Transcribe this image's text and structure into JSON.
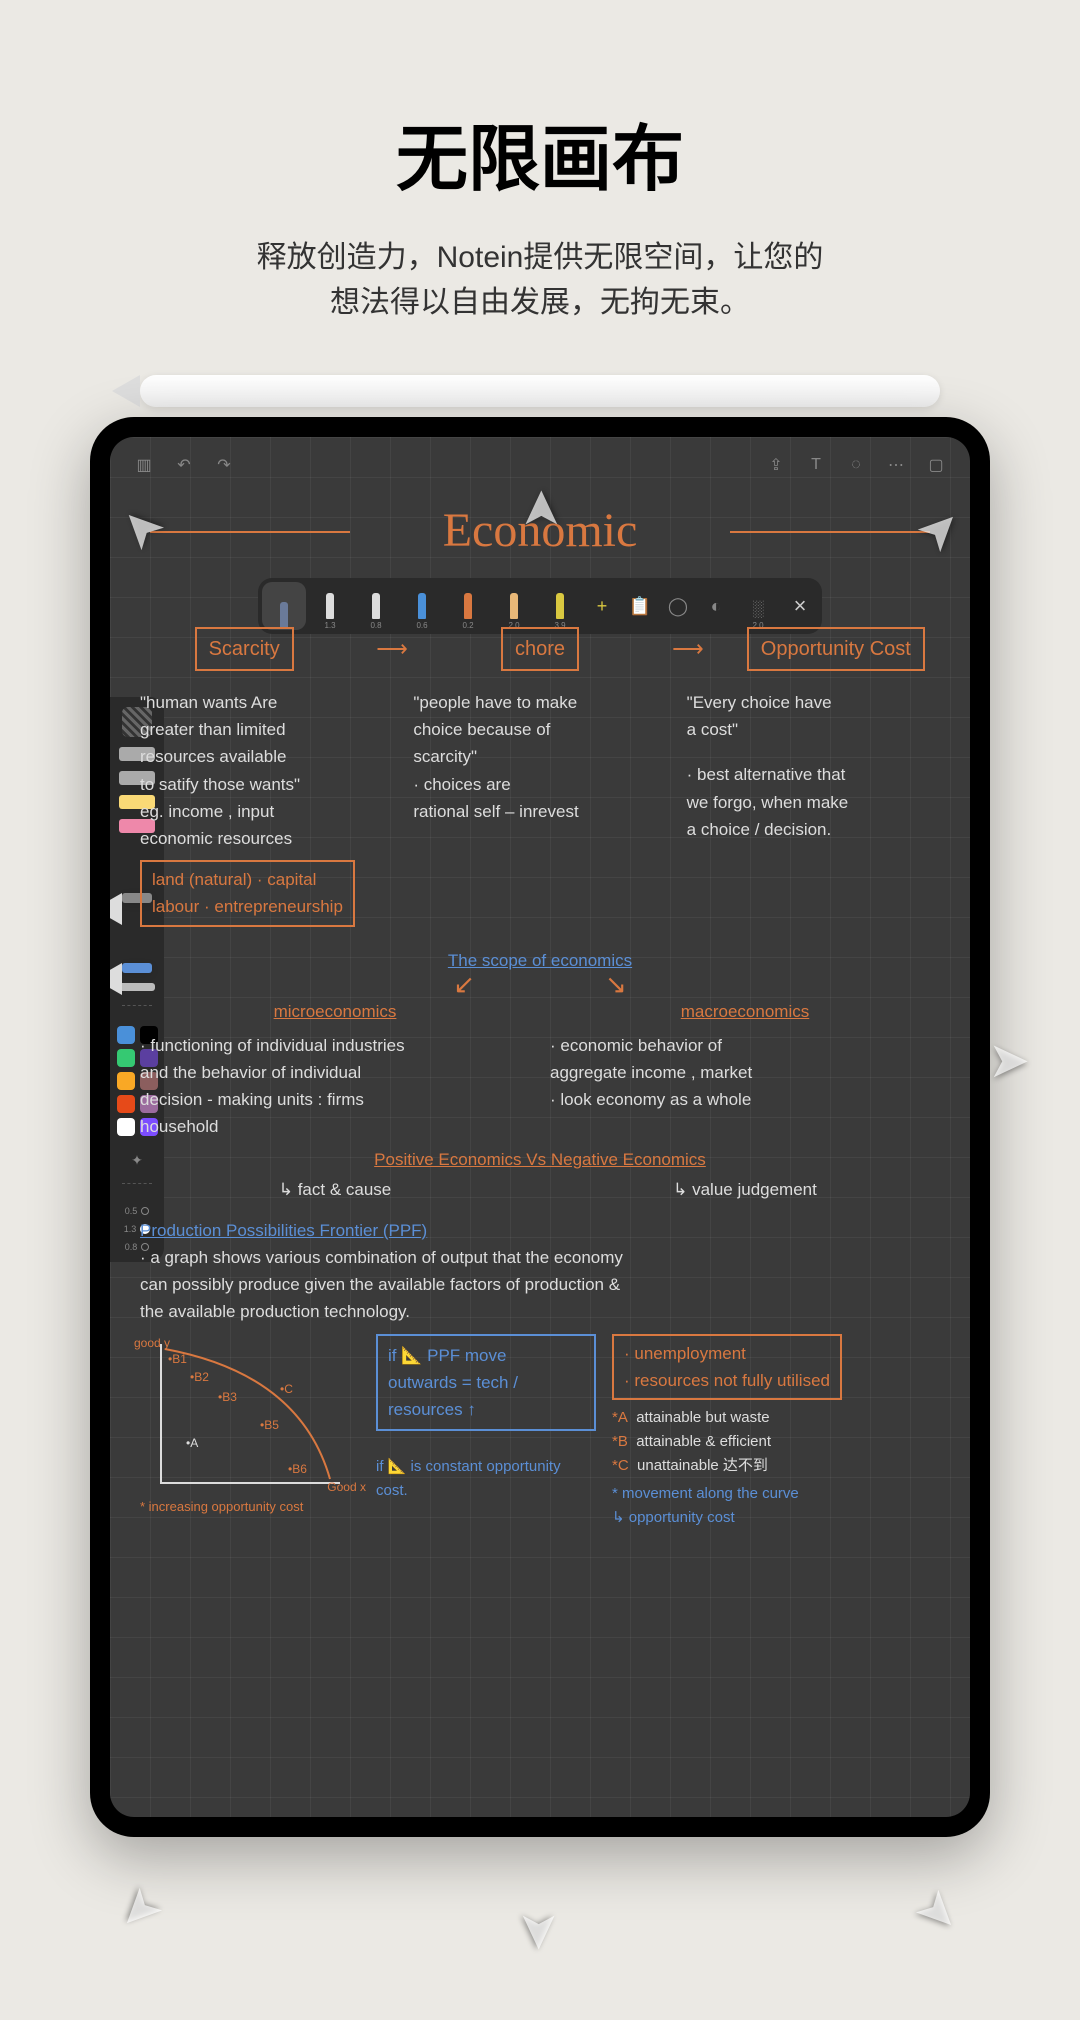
{
  "hero": {
    "title": "无限画布",
    "subtitle_line1": "释放创造力，Notein提供无限空间，让您的",
    "subtitle_line2": "想法得以自由发展，无拘无束。"
  },
  "toolbar": {
    "pens": [
      {
        "color": "#6a7a99",
        "size": "",
        "active": true
      },
      {
        "color": "#dddddd",
        "size": "1.3"
      },
      {
        "color": "#dddddd",
        "size": "0.8"
      },
      {
        "color": "#4a90d9",
        "size": "0.6"
      },
      {
        "color": "#d97840",
        "size": "0.2"
      },
      {
        "color": "#e8b878",
        "size": "2.0"
      },
      {
        "color": "#d9c840",
        "size": "3.9"
      }
    ],
    "extras": [
      {
        "name": "add",
        "glyph": "+",
        "color": "#d9c840"
      },
      {
        "name": "clipboard",
        "glyph": "📋"
      },
      {
        "name": "lasso",
        "glyph": "◯"
      },
      {
        "name": "shape",
        "glyph": "◐"
      },
      {
        "name": "pattern",
        "glyph": "░",
        "size": "2.0"
      },
      {
        "name": "close",
        "glyph": "×"
      }
    ]
  },
  "side": {
    "colors": [
      "#4a90d9",
      "#000000",
      "#35c972",
      "#5b3fa0",
      "#f9a825",
      "#8b5e5e",
      "#e64a19",
      "#9b6b9e",
      "#ffffff",
      "#7c4dff"
    ],
    "sizes": [
      {
        "label": "0.5",
        "active": false
      },
      {
        "label": "1.3",
        "active": true
      },
      {
        "label": "0.8",
        "active": false
      }
    ]
  },
  "notes": {
    "title": "Economic",
    "boxes": {
      "scarcity": "Scarcity",
      "chore": "chore",
      "opportunity": "Opportunity  Cost"
    },
    "col1": {
      "l1": "\"human wants Are",
      "l2": "greater than limited",
      "l3": "resources available",
      "l4": "to satify those wants\"",
      "l5": "eg. income , input",
      "l6": "economic resources",
      "l7": "land (natural) · capital",
      "l8": "labour · entrepreneurship"
    },
    "col2": {
      "l1": "\"people have to make",
      "l2": "choice because of",
      "l3": "scarcity\"",
      "l4": "· choices are",
      "l5": "rational self – inrevest"
    },
    "col3": {
      "l1": "\"Every choice have",
      "l2": "a cost\"",
      "l3": "· best alternative that",
      "l4": "we forgo, when make",
      "l5": "a choice / decision."
    },
    "scope": "The scope of economics",
    "micro": "microeconomics",
    "macro": "macroeconomics",
    "micro_body": {
      "l1": "· functioning of individual industries",
      "l2": "and the behavior of individual",
      "l3": "decision - making units : firms",
      "l4": "household"
    },
    "macro_body": {
      "l1": "· economic behavior of",
      "l2": "aggregate income , market",
      "l3": "· look economy as a whole"
    },
    "pos_neg": "Positive Economics  Vs  Negative Economics",
    "pos": "↳ fact & cause",
    "neg": "↳ value judgement",
    "ppf_title": "Production Possibilities Frontier (PPF)",
    "ppf_body": {
      "l1": "· a graph shows various combination of output that the economy",
      "l2": "can possibly produce given the available factors of production &",
      "l3": "the available production technology."
    },
    "ppf_graph": {
      "y_label": "good y",
      "x_label": "Good x",
      "points": [
        "B1",
        "B2",
        "B3",
        "A",
        "B5",
        "B6",
        "C"
      ],
      "footer": "* increasing opportunity cost"
    },
    "ppf_box": {
      "l1": "if 📐 PPF move",
      "l2": "outwards = tech / resources ↑"
    },
    "orange_box": {
      "l1": "· unemployment",
      "l2": "· resources not fully utilised"
    },
    "legend": {
      "a": "*A  attainable but waste",
      "b": "*B  attainable & efficient",
      "c": "*C  unattainable 达不到",
      "m1": "* movement along the curve",
      "m2": "↳ opportunity cost"
    },
    "footer2": "if 📐 is constant opportunity cost."
  }
}
